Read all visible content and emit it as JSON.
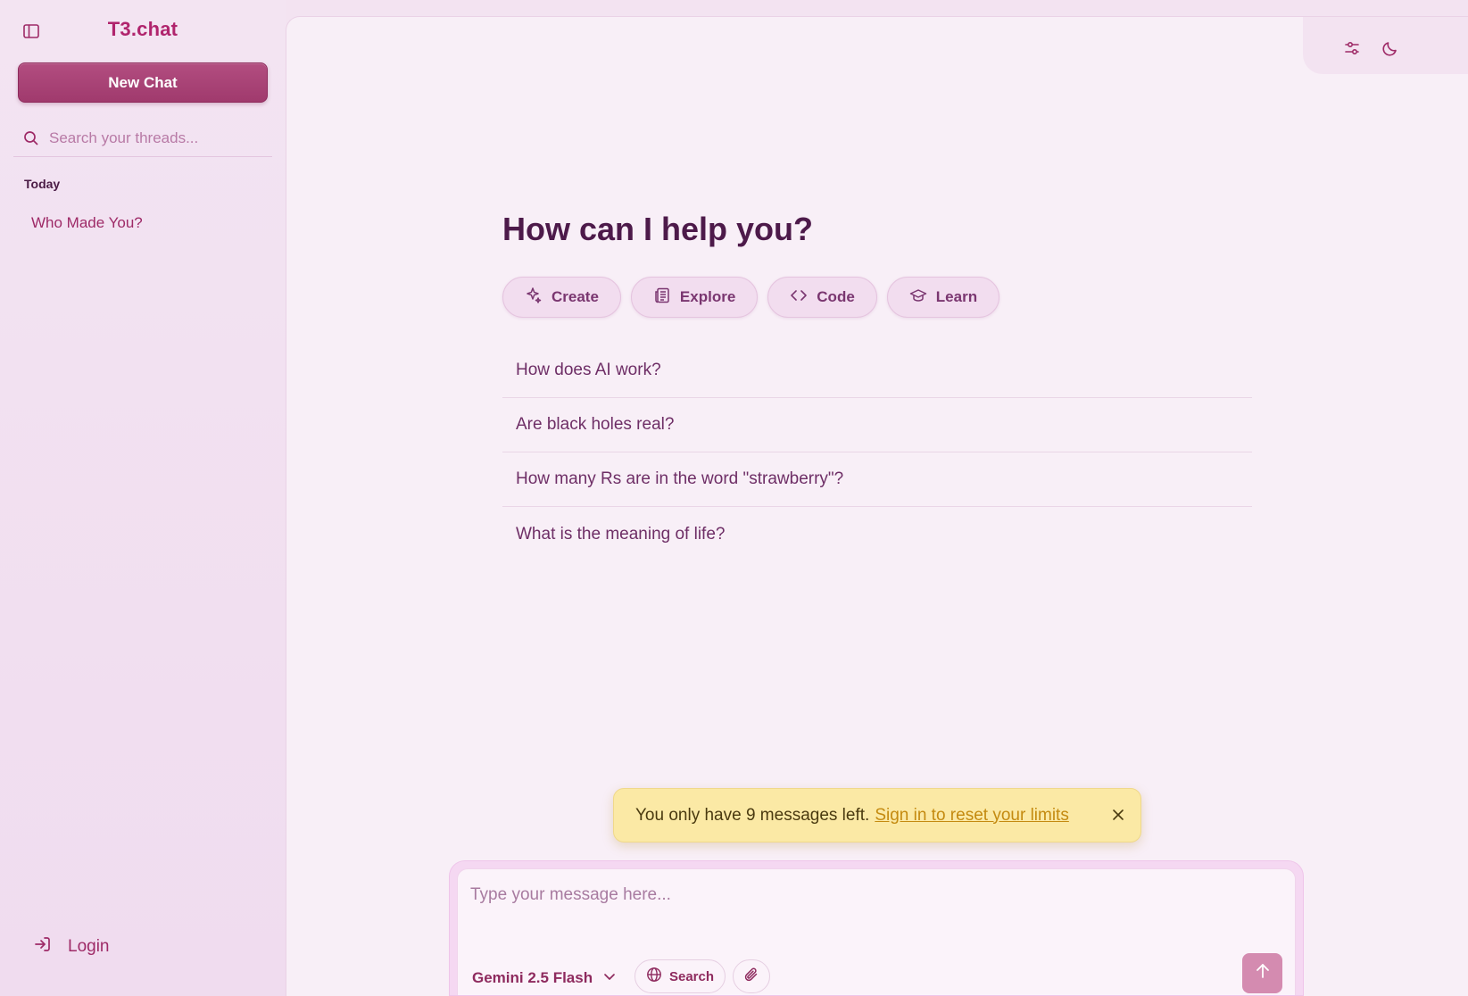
{
  "app": {
    "brand": "T3.chat"
  },
  "sidebar": {
    "new_chat_label": "New Chat",
    "search_placeholder": "Search your threads...",
    "group_label": "Today",
    "threads": [
      {
        "title": "Who Made You?"
      }
    ],
    "login_label": "Login"
  },
  "main": {
    "heading": "How can I help you?",
    "chips": [
      {
        "label": "Create",
        "icon": "sparkles-icon"
      },
      {
        "label": "Explore",
        "icon": "newspaper-icon"
      },
      {
        "label": "Code",
        "icon": "code-icon"
      },
      {
        "label": "Learn",
        "icon": "graduation-cap-icon"
      }
    ],
    "suggestions": [
      "How does AI work?",
      "Are black holes real?",
      "How many Rs are in the word \"strawberry\"?",
      "What is the meaning of life?"
    ]
  },
  "toast": {
    "message": "You only have 9 messages left.",
    "link_label": "Sign in to reset your limits"
  },
  "composer": {
    "placeholder": "Type your message here...",
    "model": "Gemini 2.5 Flash",
    "search_label": "Search"
  },
  "colors": {
    "accent": "#b0246d",
    "new_chat_bg": "#a03a6d",
    "toast_bg": "#fbe9a5",
    "send_bg": "#d48bb0"
  }
}
